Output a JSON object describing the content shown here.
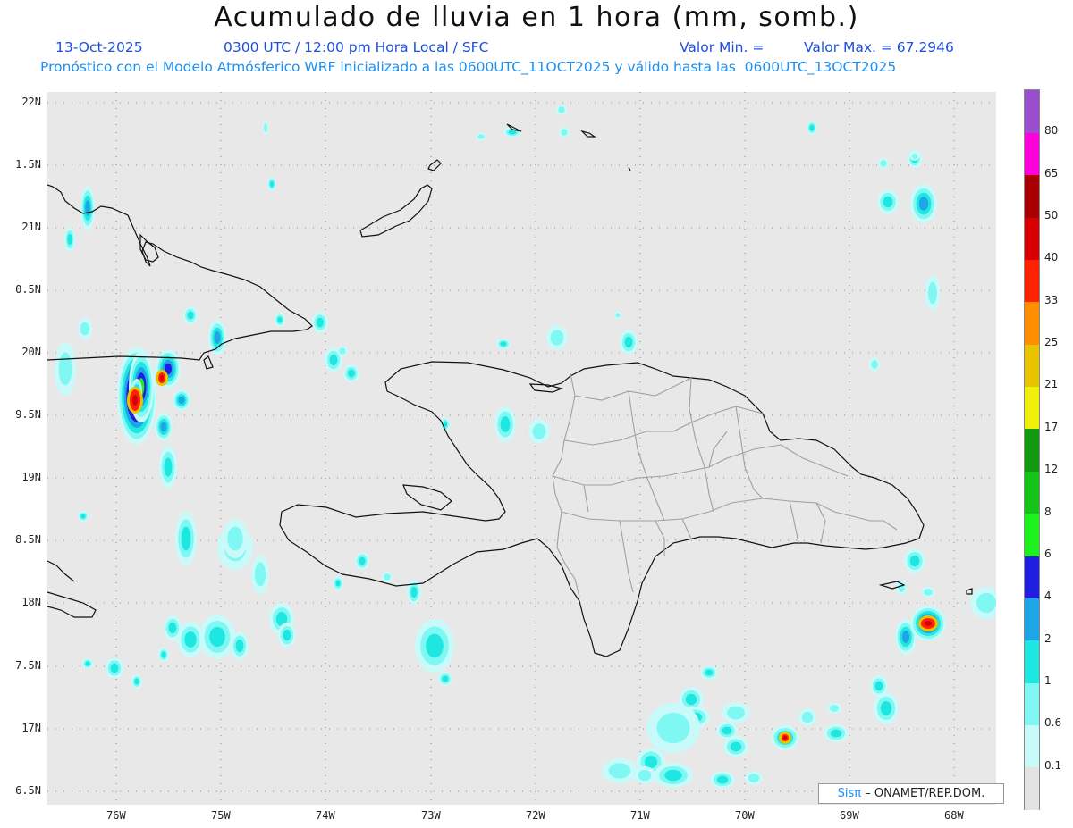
{
  "header": {
    "title": "Acumulado de lluvia en 1 hora (mm, somb.)",
    "date": "13-Oct-2025",
    "time": "0300 UTC / 12:00 pm Hora Local / SFC",
    "min_label": "Valor Min. =",
    "max_label": "Valor Max. = 67.2946",
    "forecast_note": "Pronóstico con el Modelo Atmósferico WRF inicializado a las 0600UTC_11OCT2025 y válido hasta las  0600UTC_13OCT2025"
  },
  "map": {
    "lon_labels": [
      "76W",
      "75W",
      "74W",
      "73W",
      "72W",
      "71W",
      "70W",
      "69W",
      "68W"
    ],
    "lat_labels": [
      "22N",
      "1.5N",
      "21N",
      "0.5N",
      "20N",
      "9.5N",
      "19N",
      "8.5N",
      "18N",
      "7.5N",
      "17N",
      "6.5N"
    ]
  },
  "legend": {
    "levels": [
      "0.1",
      "0.6",
      "1",
      "2",
      "4",
      "6",
      "8",
      "12",
      "17",
      "21",
      "25",
      "33",
      "40",
      "50",
      "65",
      "80"
    ],
    "colors": [
      "#e3e3e3",
      "#c8fafa",
      "#7ff7f2",
      "#1ee6e0",
      "#1ea5e8",
      "#1f1fe0",
      "#1ef21e",
      "#17c317",
      "#0f9a0f",
      "#f0f00a",
      "#e8c300",
      "#ff8f00",
      "#ff2200",
      "#d60000",
      "#a80000",
      "#ff00dc",
      "#9a4ecf"
    ]
  },
  "credit": {
    "brand": "Sisπ",
    "text": "– ONAMET/REP.DOM."
  }
}
